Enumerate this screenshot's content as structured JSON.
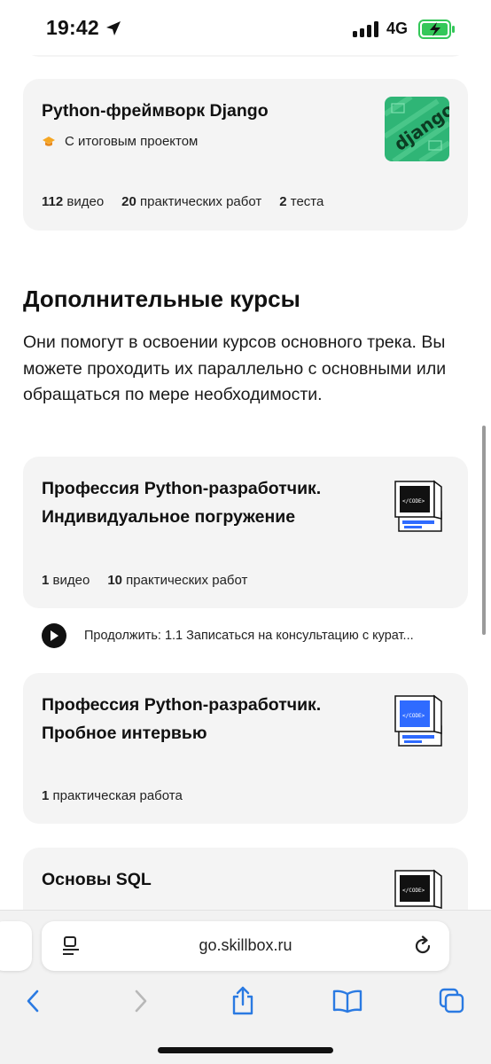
{
  "status_bar": {
    "time": "19:42",
    "network": "4G",
    "battery_color": "#34c759"
  },
  "django_card": {
    "title": "Python-фреймворк Django",
    "badge_text": "С итоговым проектом",
    "badge_icon": "graduation-cap-icon",
    "thumb_text": "django",
    "stats": [
      {
        "count": "112",
        "label": "видео"
      },
      {
        "count": "20",
        "label": "практических работ"
      },
      {
        "count": "2",
        "label": "теста"
      }
    ]
  },
  "extra_section": {
    "title": "Дополнительные курсы",
    "description": "Они помогут в освоении курсов основного трека. Вы можете проходить их параллельно с основными или обращаться по мере необходимости."
  },
  "course_cards": [
    {
      "title_line1": "Профессия Python-разработчик.",
      "title_line2": "Индивидуальное погружение",
      "stats": [
        {
          "count": "1",
          "label": "видео"
        },
        {
          "count": "10",
          "label": "практических работ"
        }
      ]
    },
    {
      "title_line1": "Профессия Python-разработчик.",
      "title_line2": "Пробное интервью",
      "stats": [
        {
          "count": "1",
          "label": "практическая работа"
        }
      ]
    },
    {
      "title_line1": "Основы SQL"
    }
  ],
  "continue": {
    "text": "Продолжить: 1.1 Записаться на консультацию с курат..."
  },
  "browser": {
    "url": "go.skillbox.ru"
  },
  "colors": {
    "card_bg": "#f4f4f4",
    "accent_blue": "#2f6bff",
    "django_green": "#2fb576"
  }
}
